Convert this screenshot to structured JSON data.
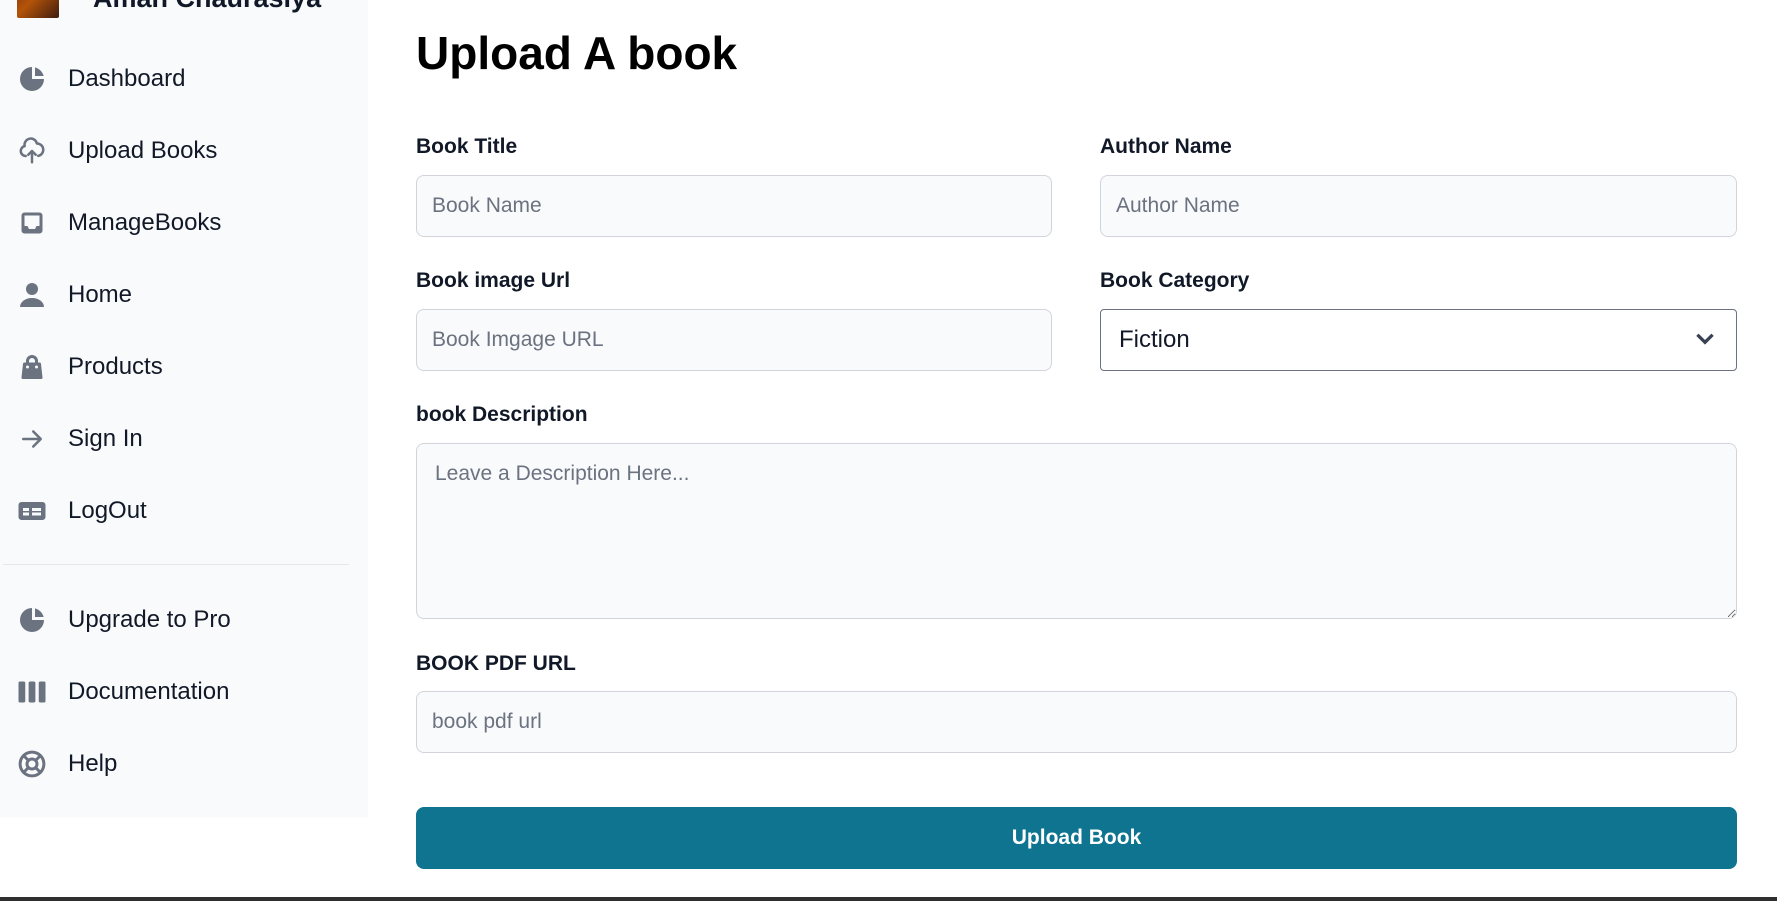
{
  "sidebar": {
    "profile_name": "Aman Chaurasiya",
    "nav": [
      {
        "label": "Dashboard",
        "icon": "pie-chart-icon"
      },
      {
        "label": "Upload Books",
        "icon": "cloud-upload-icon"
      },
      {
        "label": "ManageBooks",
        "icon": "inbox-icon"
      },
      {
        "label": "Home",
        "icon": "user-icon"
      },
      {
        "label": "Products",
        "icon": "shopping-bag-icon"
      },
      {
        "label": "Sign In",
        "icon": "arrow-right-icon"
      },
      {
        "label": "LogOut",
        "icon": "table-icon"
      }
    ],
    "secondary_nav": [
      {
        "label": "Upgrade to Pro",
        "icon": "pie-chart-icon"
      },
      {
        "label": "Documentation",
        "icon": "view-columns-icon"
      },
      {
        "label": "Help",
        "icon": "lifebuoy-icon"
      }
    ]
  },
  "main": {
    "title": "Upload A book",
    "form": {
      "book_title": {
        "label": "Book Title",
        "placeholder": "Book Name",
        "value": ""
      },
      "author_name": {
        "label": "Author Name",
        "placeholder": "Author Name",
        "value": ""
      },
      "book_image_url": {
        "label": "Book image Url",
        "placeholder": "Book Imgage URL",
        "value": ""
      },
      "book_category": {
        "label": "Book Category",
        "selected": "Fiction"
      },
      "book_description": {
        "label": "book Description",
        "placeholder": "Leave a Description Here...",
        "value": ""
      },
      "book_pdf_url": {
        "label": "BOOK PDF URL",
        "placeholder": "book pdf url",
        "value": ""
      },
      "submit_label": "Upload Book"
    }
  },
  "colors": {
    "primary_button": "#0e7490",
    "sidebar_bg": "#f9fafb",
    "icon_gray": "#6b7280"
  }
}
